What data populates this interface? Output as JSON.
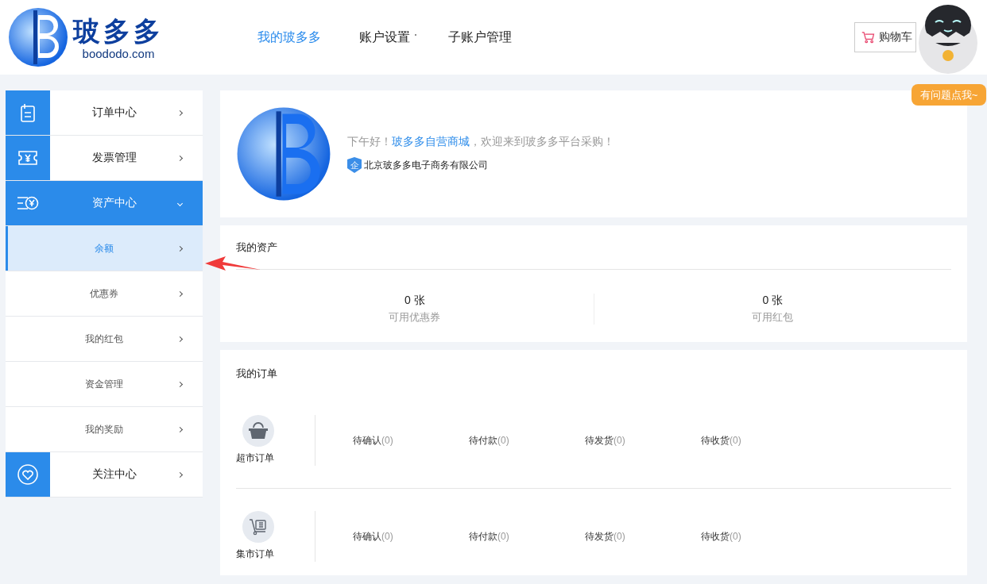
{
  "header": {
    "logo": {
      "name": "玻多多",
      "domain": "boododo.com"
    },
    "nav": [
      {
        "label": "我的玻多多",
        "selected": true,
        "dropdown": false
      },
      {
        "label": "账户设置",
        "selected": false,
        "dropdown": true
      },
      {
        "label": "子账户管理",
        "selected": false,
        "dropdown": false
      }
    ],
    "cart": "购物车"
  },
  "assistant": {
    "bubble": "有问题点我~"
  },
  "sidebar": {
    "items": [
      {
        "label": "订单中心",
        "expanded": false
      },
      {
        "label": "发票管理",
        "expanded": false
      },
      {
        "label": "资产中心",
        "expanded": true,
        "children": [
          {
            "label": "余额",
            "selected": true
          },
          {
            "label": "优惠券",
            "selected": false
          },
          {
            "label": "我的红包",
            "selected": false
          },
          {
            "label": "资金管理",
            "selected": false
          },
          {
            "label": "我的奖励",
            "selected": false
          }
        ]
      },
      {
        "label": "关注中心",
        "expanded": false
      }
    ]
  },
  "profile": {
    "greeting": {
      "before": "下午好！",
      "link": "玻多多自营商城",
      "after": "，欢迎来到玻多多平台采购！"
    },
    "badge": "企",
    "company": "北京玻多多电子商务有限公司"
  },
  "assets": {
    "title": "我的资产",
    "stats": [
      {
        "value": "0 张",
        "label": "可用优惠券"
      },
      {
        "value": "0 张",
        "label": "可用红包"
      }
    ]
  },
  "orders": {
    "title": "我的订单",
    "rows": [
      {
        "name": "超市订单",
        "statuses": [
          {
            "label": "待确认",
            "count": "(0)"
          },
          {
            "label": "待付款",
            "count": "(0)"
          },
          {
            "label": "待发货",
            "count": "(0)"
          },
          {
            "label": "待收货",
            "count": "(0)"
          }
        ]
      },
      {
        "name": "集市订单",
        "statuses": [
          {
            "label": "待确认",
            "count": "(0)"
          },
          {
            "label": "待付款",
            "count": "(0)"
          },
          {
            "label": "待发货",
            "count": "(0)"
          },
          {
            "label": "待收货",
            "count": "(0)"
          }
        ]
      }
    ]
  }
}
